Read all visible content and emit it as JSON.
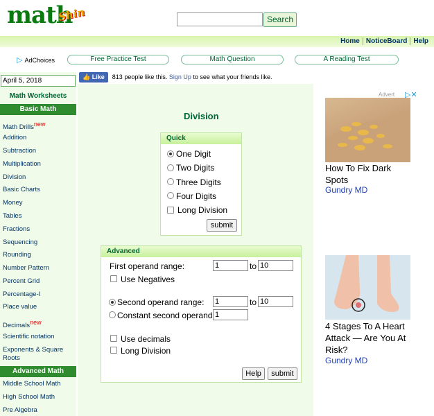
{
  "logo": {
    "main": "math",
    "accent": "Shin"
  },
  "search": {
    "placeholder": "",
    "button": "Search"
  },
  "topnav": [
    "Home",
    "NoticeBoard",
    "Help"
  ],
  "adchoices": "AdChoices",
  "pills": [
    "Free Practice Test",
    "Math Question",
    "A Reading Test"
  ],
  "date": "April 5, 2018",
  "facebook": {
    "like": "Like",
    "count_text": "813 people like this.",
    "signup": "Sign Up",
    "rest": "to see what your friends like."
  },
  "sidebar": {
    "title": "Math Worksheets",
    "basic_head": "Basic Math",
    "basic_items": [
      "Math Drills",
      "Addition",
      "Subtraction",
      "Multiplication",
      "Division",
      "Basic Charts",
      "Money",
      "Tables",
      "Fractions",
      "Sequencing",
      "Rounding",
      "Number Pattern",
      "Percent Grid",
      "Percentage-I",
      "Place value",
      "Decimals",
      "Scientific notation",
      "Exponents & Square Roots"
    ],
    "new_badge": "new",
    "advanced_head": "Advanced Math",
    "advanced_items": [
      "Middle School Math",
      "High School Math",
      "Pre Algebra"
    ]
  },
  "main": {
    "title": "Division",
    "quick": {
      "head": "Quick",
      "options": [
        "One Digit",
        "Two Digits",
        "Three Digits",
        "Four Digits"
      ],
      "checkbox": "Long Division",
      "submit": "submit"
    },
    "advanced": {
      "head": "Advanced",
      "first_range_label": "First operand range:",
      "first_from": "1",
      "to": "to",
      "first_to": "10",
      "negatives": "Use Negatives",
      "second_range_label": "Second operand range:",
      "second_from": "1",
      "second_to": "10",
      "constant_label": "Constant second operand:",
      "constant_value": "1",
      "decimals": "Use decimals",
      "long_division": "Long Division",
      "help": "Help",
      "submit": "submit"
    }
  },
  "ads": {
    "label": "Advert",
    "ad1": {
      "title": "How To Fix Dark Spots",
      "source": "Gundry MD"
    },
    "ad2": {
      "title": "4 Stages To A Heart Attack — Are You At Risk?",
      "source": "Gundry MD"
    }
  }
}
